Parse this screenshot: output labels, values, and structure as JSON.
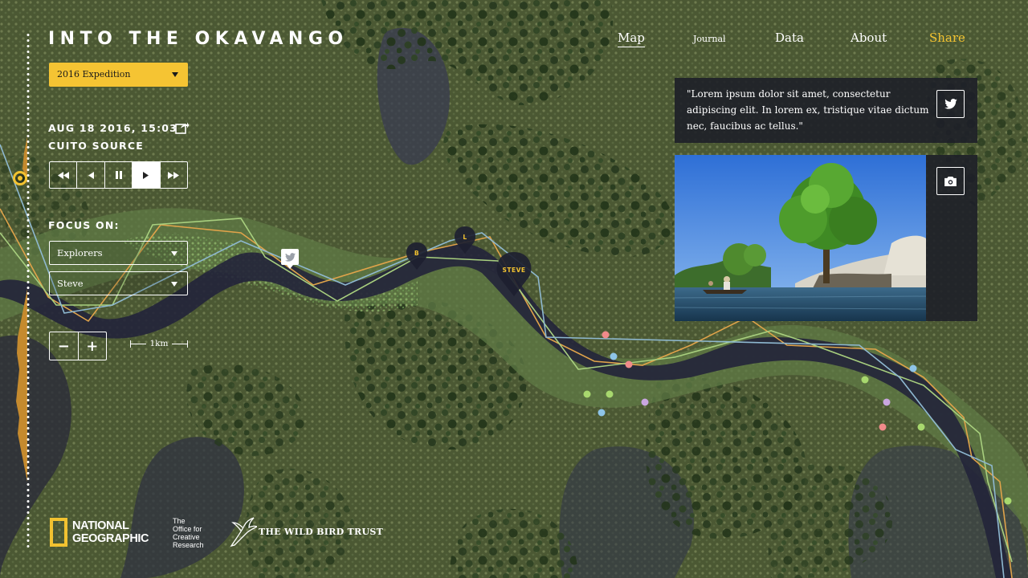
{
  "header": {
    "site_title": "INTO THE OKAVANGO",
    "nav": [
      {
        "label": "Map",
        "active": true
      },
      {
        "label": "Journal"
      },
      {
        "label": "Data"
      },
      {
        "label": "About"
      },
      {
        "label": "Share",
        "accent": "#f2c230"
      }
    ]
  },
  "expedition_select": {
    "value": "2016 Expedition"
  },
  "status": {
    "date": "AUG 18 2016, 15:03",
    "location": "CUITO SOURCE"
  },
  "playback": {
    "buttons": [
      "fast-rewind-icon",
      "step-back-icon",
      "pause-icon",
      "play-icon",
      "fast-forward-icon"
    ],
    "active": "play-icon"
  },
  "focus": {
    "label": "FOCUS ON:",
    "group_select": "Explorers",
    "member_select": "Steve"
  },
  "zoom": {
    "minus": "−",
    "plus": "+"
  },
  "scale": {
    "label": "1km"
  },
  "map": {
    "markers": [
      {
        "label": "B"
      },
      {
        "label": "L"
      },
      {
        "label": "STEVE"
      }
    ],
    "route_colors": [
      "#e0a34a",
      "#a8cf7e",
      "#8eb8d0"
    ],
    "sighting_colors": [
      "#f08a8a",
      "#a8d86e",
      "#8ec4e8",
      "#c9a6e0"
    ]
  },
  "quote_card": {
    "text": "\"Lorem ipsum dolor sit amet, consectetur adipiscing elit. In lorem ex, tristique vitae dictum nec, faucibus ac tellus.\""
  },
  "footer": {
    "natgeo": [
      "NATIONAL",
      "GEOGRAPHIC"
    ],
    "ocr": [
      "The",
      "Office for",
      "Creative",
      "Research"
    ],
    "wildbird": "THE WILD BIRD TRUST"
  },
  "colors": {
    "accent": "#f2c230",
    "panel": "#1c1e28"
  }
}
